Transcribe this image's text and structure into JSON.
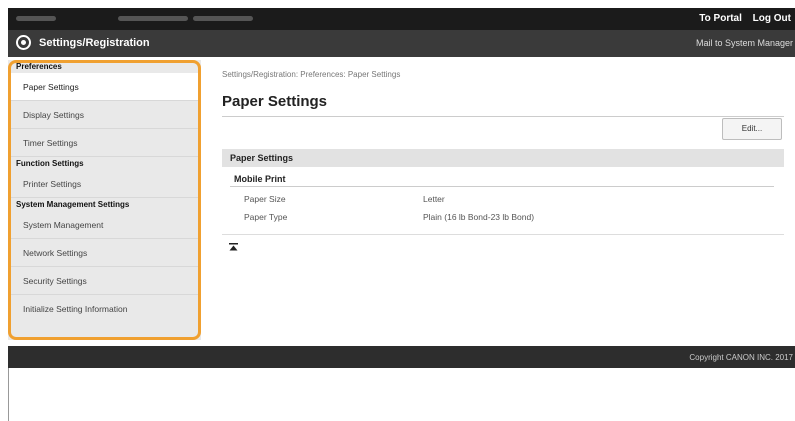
{
  "header": {
    "top_links": [
      "To Portal",
      "Log Out"
    ],
    "app_title": "Settings/Registration",
    "mail_link": "Mail to System Manager"
  },
  "sidebar": {
    "sections": [
      {
        "title": "Preferences",
        "items": [
          "Paper Settings",
          "Display Settings",
          "Timer Settings"
        ]
      },
      {
        "title": "Function Settings",
        "items": [
          "Printer Settings"
        ]
      },
      {
        "title": "System Management Settings",
        "items": [
          "System Management",
          "Network Settings",
          "Security Settings",
          "Initialize Setting Information"
        ]
      }
    ],
    "active_item": "Paper Settings"
  },
  "main": {
    "breadcrumb": "Settings/Registration: Preferences: Paper Settings",
    "title": "Paper Settings",
    "edit_label": "Edit...",
    "section_title": "Paper Settings",
    "subsection_title": "Mobile Print",
    "rows": [
      {
        "label": "Paper Size",
        "value": "Letter"
      },
      {
        "label": "Paper Type",
        "value": "Plain (16 lb Bond-23 lb Bond)"
      }
    ]
  },
  "footer": {
    "copyright": "Copyright CANON INC. 2017"
  },
  "colors": {
    "highlight": "#f0a030",
    "topbar": "#1b1b1b",
    "titlebar": "#3a3a3a"
  }
}
